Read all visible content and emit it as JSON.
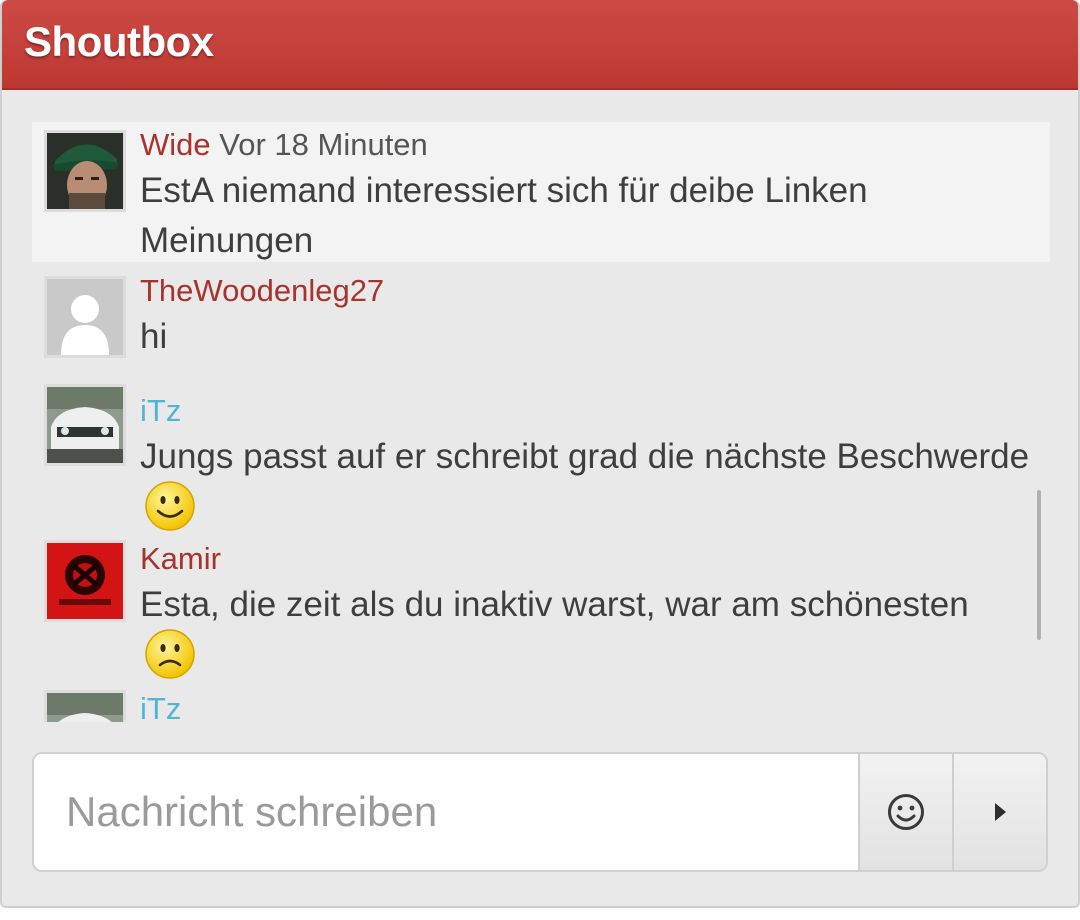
{
  "header": {
    "title": "Shoutbox"
  },
  "messages": [
    {
      "user": "Wide",
      "time": "Vor 18 Minuten",
      "text": "EstA niemand interessiert sich für deibe Linken Meinungen"
    },
    {
      "user": "TheWoodenleg27",
      "time": "",
      "text": "hi"
    },
    {
      "user": "iTz",
      "time": "",
      "text": "Jungs passt auf er schreibt grad die nächste Beschwerde"
    },
    {
      "user": "Kamir",
      "time": "",
      "text": "Esta, die zeit als du inaktiv warst, war am schönesten"
    },
    {
      "user": "iTz",
      "time": "",
      "text": ""
    }
  ],
  "icons": {
    "smile": "smiley-happy-icon",
    "sad": "smiley-sad-icon",
    "emoji_button": "emoji-icon",
    "send_button": "send-arrow-icon"
  },
  "input": {
    "placeholder": "Nachricht schreiben",
    "value": ""
  },
  "colors": {
    "header": "#c4403a",
    "username_red": "#a8332c",
    "username_blue": "#4fb6d8"
  }
}
